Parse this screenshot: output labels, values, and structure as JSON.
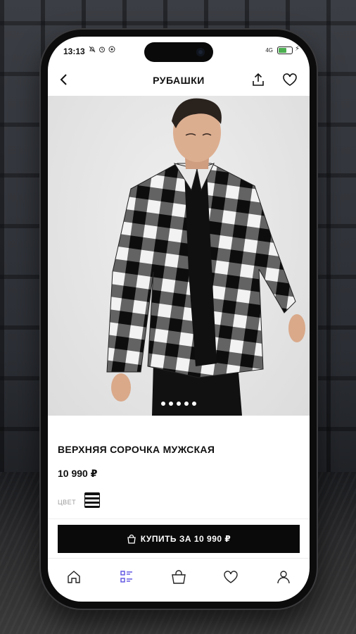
{
  "status": {
    "time": "13:13",
    "icons": [
      "silent-icon",
      "alarm-icon",
      "notification-icon"
    ],
    "signal": "4G",
    "battery_level": 0.6
  },
  "nav": {
    "title": "РУБАШКИ",
    "back_icon": "chevron-left-icon",
    "share_icon": "share-icon",
    "fav_icon": "heart-icon"
  },
  "gallery": {
    "image": "model wearing black-and-white checked shirt",
    "pages": 5,
    "active_page": 1
  },
  "product": {
    "name": "ВЕРХНЯЯ СОРОЧКА МУЖСКАЯ",
    "price": "10 990 ₽",
    "color_label": "ЦВЕТ",
    "color_swatch": "black-white-check"
  },
  "buy_button": {
    "label": "КУПИТЬ ЗА 10 990 ₽",
    "icon": "bag-icon"
  },
  "tabbar": [
    {
      "name": "home",
      "icon": "home-icon",
      "active": false
    },
    {
      "name": "catalog",
      "icon": "catalog-icon",
      "active": true
    },
    {
      "name": "cart",
      "icon": "bag-icon",
      "active": false
    },
    {
      "name": "favorites",
      "icon": "heart-icon",
      "active": false
    },
    {
      "name": "profile",
      "icon": "user-icon",
      "active": false
    }
  ],
  "colors": {
    "accent": "#5b4fe0",
    "text": "#111111",
    "button": "#0a0a0a"
  }
}
